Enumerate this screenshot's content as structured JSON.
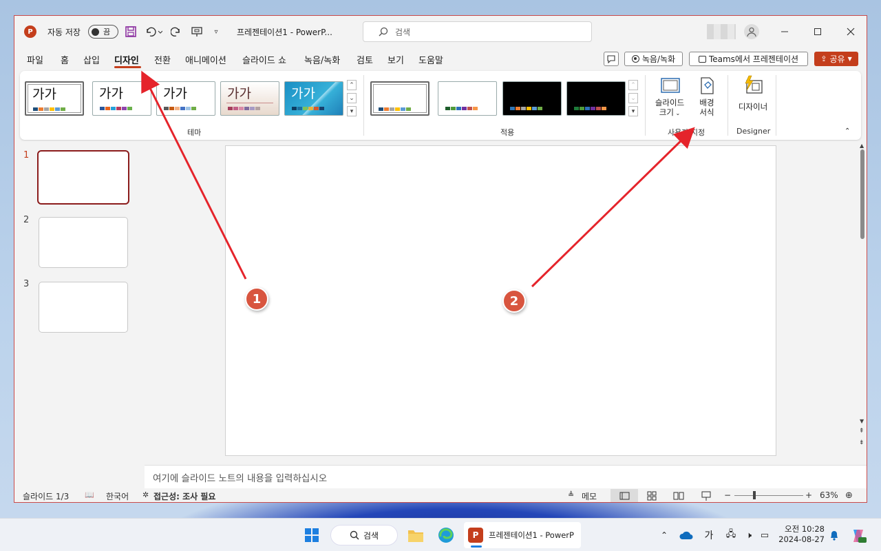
{
  "app": {
    "autosave_label": "자동 저장",
    "autosave_state": "끔",
    "doc_title": "프레젠테이션1  -  PowerP...",
    "search_placeholder": "검색"
  },
  "menu": [
    "파일",
    "홈",
    "삽입",
    "디자인",
    "전환",
    "애니메이션",
    "슬라이드 쇼",
    "녹음/녹화",
    "검토",
    "보기",
    "도움말"
  ],
  "right_buttons": {
    "record": "녹음/녹화",
    "teams": "Teams에서 프레젠테이션",
    "share": "공유"
  },
  "ribbon": {
    "theme_sample": "가가",
    "theme_group": "테마",
    "variant_group": "적용",
    "slide_size_l1": "슬라이드",
    "slide_size_l2": "크기",
    "bg_format_l1": "배경",
    "bg_format_l2": "서식",
    "customize_group": "사용자 지정",
    "designer_label": "디자이너",
    "designer_group": "Designer"
  },
  "slides": {
    "nums": [
      "1",
      "2",
      "3"
    ]
  },
  "notes_placeholder": "여기에 슬라이드 노트의 내용을 입력하십시오",
  "status": {
    "slide_count": "슬라이드 1/3",
    "language": "한국어",
    "accessibility": "접근성: 조사 필요",
    "notes": "메모",
    "zoom": "63%"
  },
  "taskbar": {
    "search": "검색",
    "ppt_window": "프레젠테이션1 - PowerP",
    "ime": "가",
    "time": "오전 10:28",
    "date": "2024-08-27"
  },
  "callouts": [
    "1",
    "2"
  ],
  "colors": {
    "accent": "#c43e1c",
    "callout": "#d8553f",
    "arrow": "#e5242b",
    "selected_slide": "#8b1c1c"
  }
}
